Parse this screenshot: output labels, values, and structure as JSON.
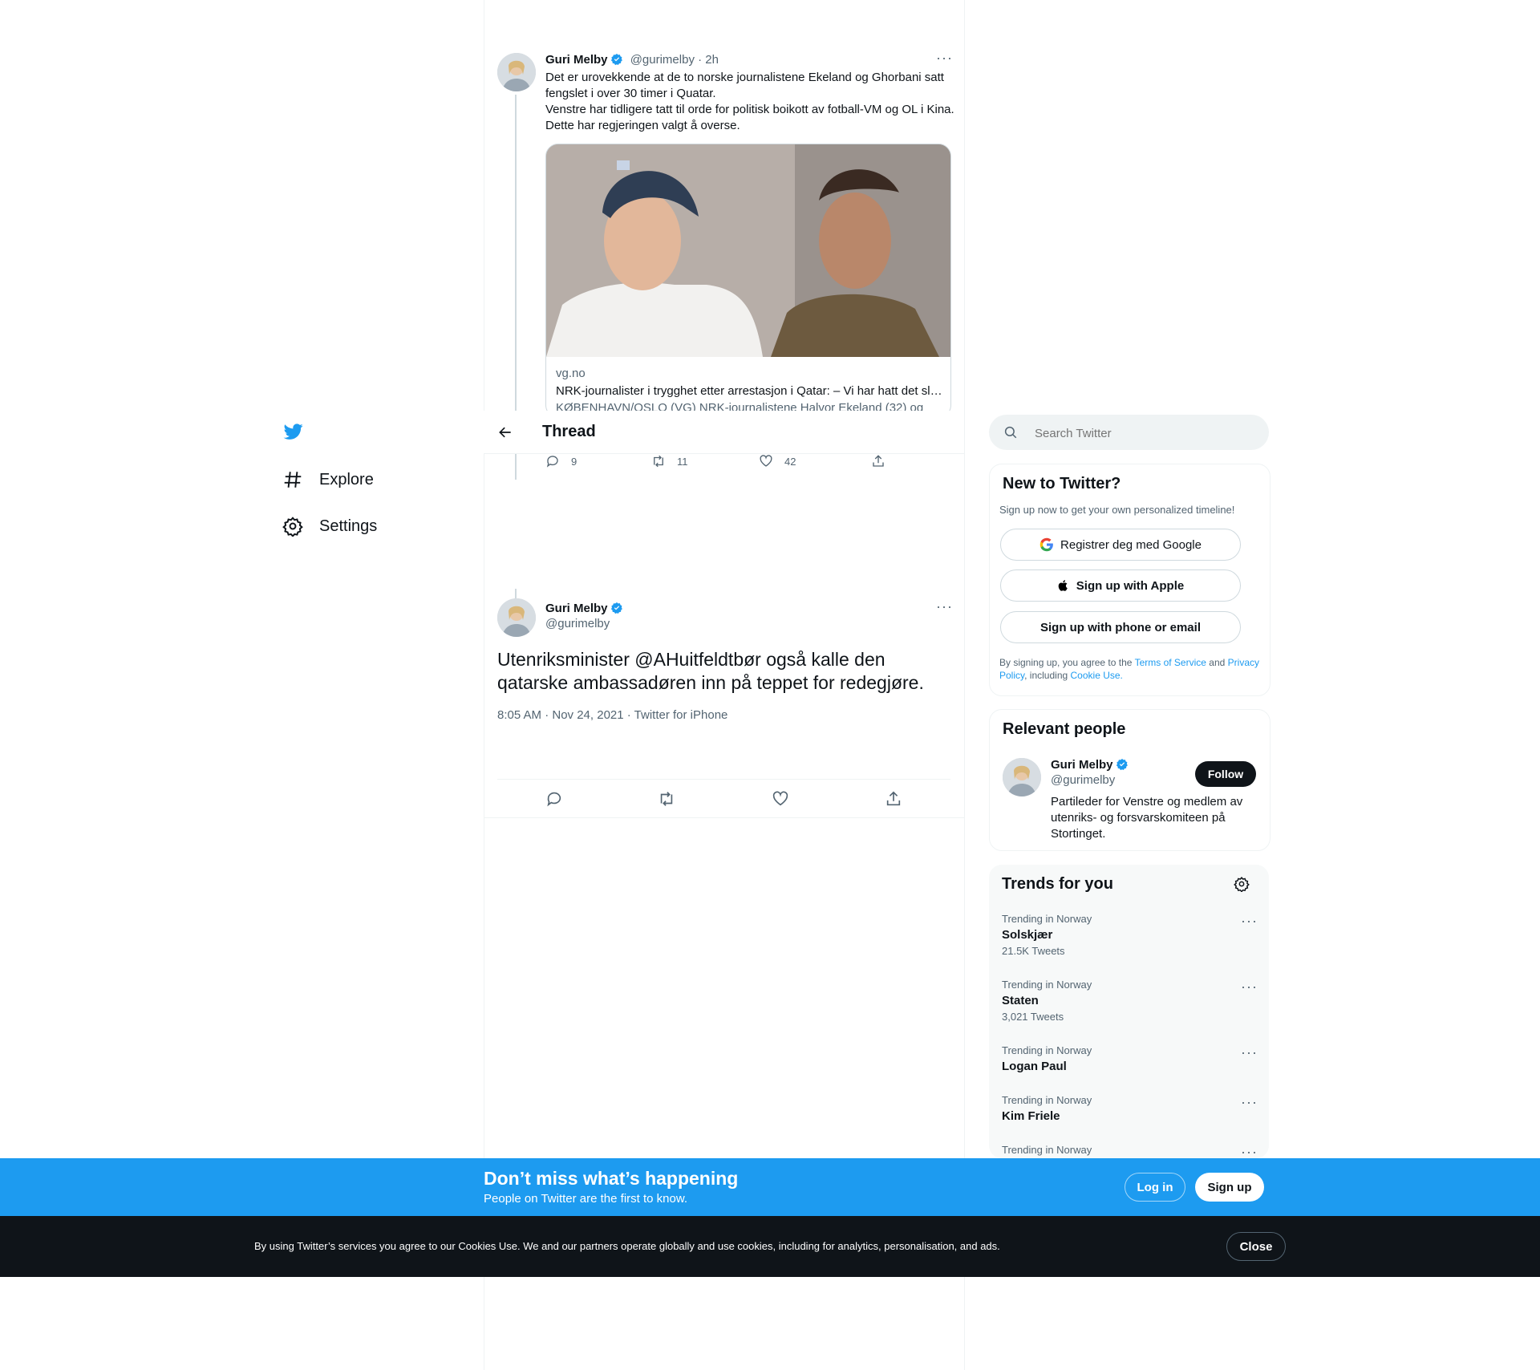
{
  "nav": {
    "items": [
      {
        "label": "Explore",
        "icon": "hashtag-icon"
      },
      {
        "label": "Settings",
        "icon": "gear-icon"
      }
    ]
  },
  "header": {
    "title": "Thread"
  },
  "search": {
    "placeholder": "Search Twitter"
  },
  "parent_tweet": {
    "name": "Guri Melby",
    "handle": "@gurimelby",
    "time": "· 2h",
    "text_1": "Det er urovekkende at de to norske journalistene Ekeland og Ghorbani satt fengslet i over 30 timer i Quatar.",
    "text_2": "Venstre har tidligere tatt til orde for politisk boikott av fotball-VM og OL i Kina. Dette har regjeringen valgt å overse.",
    "card": {
      "domain": "vg.no",
      "title": "NRK-journalister i trygghet etter arrestasjon i Qatar: – Vi har hatt det sl…",
      "description": "KØBENHAVN/OSLO (VG) NRK-journalistene Halvor Ekeland (32) og"
    },
    "replies": "9",
    "retweets": "11",
    "likes": "42"
  },
  "main_tweet": {
    "name": "Guri Melby",
    "handle": "@gurimelby",
    "text": "Utenriksminister @AHuitfeldtbør også kalle den qatarske ambassadøren inn på teppet for redegjøre.",
    "meta": "8:05 AM · Nov 24, 2021 · Twitter for iPhone"
  },
  "new_to_twitter": {
    "title": "New to Twitter?",
    "subtitle": "Sign up now to get your own personalized timeline!",
    "google_label": "Registrer deg med Google",
    "apple_label": "Sign up with Apple",
    "phone_label": "Sign up with phone or email",
    "legal_1": "By signing up, you agree to the",
    "terms": "Terms of Service",
    "legal_2": "and",
    "privacy": "Privacy Policy",
    "legal_3": ", including",
    "cookie": "Cookie Use."
  },
  "relevant": {
    "title": "Relevant people",
    "name": "Guri Melby",
    "handle": "@gurimelby",
    "follow_label": "Follow",
    "bio": "Partileder for Venstre og medlem av utenriks- og forsvarskomiteen på Stortinget."
  },
  "trends": {
    "title": "Trends for you",
    "items": [
      {
        "context": "Trending in Norway",
        "name": "Solskjær",
        "count": "21.5K Tweets"
      },
      {
        "context": "Trending in Norway",
        "name": "Staten",
        "count": "3,021 Tweets"
      },
      {
        "context": "Trending in Norway",
        "name": "Logan Paul",
        "count": ""
      },
      {
        "context": "Trending in Norway",
        "name": "Kim Friele",
        "count": ""
      },
      {
        "context": "Trending in Norway",
        "name": "",
        "count": ""
      }
    ]
  },
  "signup_bar": {
    "title": "Don’t miss what’s happening",
    "subtitle": "People on Twitter are the first to know.",
    "login_label": "Log in",
    "signup_label": "Sign up"
  },
  "cookie_bar": {
    "text": "By using Twitter’s services you agree to our Cookies Use. We and our partners operate globally and use cookies, including for analytics, personalisation, and ads.",
    "close_label": "Close"
  },
  "colors": {
    "brand": "#1d9bf0",
    "dark": "#0f1419",
    "muted": "#536471"
  }
}
